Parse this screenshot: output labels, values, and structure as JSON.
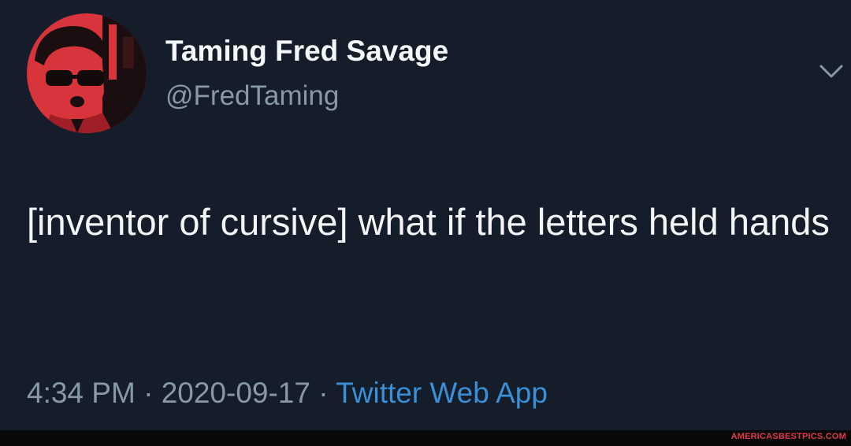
{
  "tweet": {
    "display_name": "Taming Fred Savage",
    "handle": "@FredTaming",
    "text": "[inventor of cursive] what if the letters held hands",
    "time": "4:34 PM",
    "separator": "·",
    "date": "2020-09-17",
    "source": "Twitter Web App",
    "avatar_icon": "profile-avatar",
    "menu_icon": "chevron-down-icon"
  },
  "watermark": "AMERICASBESTPICS.COM",
  "colors": {
    "background": "#15202b",
    "name": "#f5f8fa",
    "secondary": "#8899a6",
    "link": "#3a8fd6",
    "avatar_red": "#d8343c"
  }
}
